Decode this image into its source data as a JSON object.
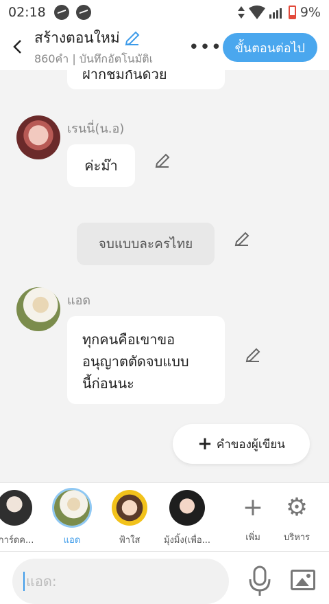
{
  "status": {
    "time": "02:18",
    "battery": "9%"
  },
  "header": {
    "back_glyph": "<",
    "title": "สร้างตอนใหม่",
    "subtitle": "860คำ | บันทึกอัตโนมัติเ",
    "more_glyph": "•••",
    "next_label": "ขั้นตอนต่อไป"
  },
  "chat": {
    "top_partial": "ฝากชมกันด้วย",
    "msg1": {
      "name": "เรนนี่(น.อ)",
      "text": "ค่ะม๊า"
    },
    "narration": "จบแบบละครไทย",
    "msg2": {
      "name": "แอด",
      "lines": [
        "ทุกคนคือเขาขอ",
        "อนุญาตตัดจบแบบ",
        "นี้ก่อนนะ"
      ]
    },
    "author_button": "คำของผู้เขียน",
    "author_plus": "+"
  },
  "characters": [
    {
      "label": "(การ์ดค..."
    },
    {
      "label": "แอด"
    },
    {
      "label": "ฟ้าใส"
    },
    {
      "label": "มุ้งมิ้ง(เพื่อ..."
    }
  ],
  "tools": {
    "add_label": "เพิ่ม",
    "manage_label": "บริหาร",
    "add_glyph": "+",
    "manage_glyph": "⚙"
  },
  "input": {
    "placeholder": "แอด:"
  },
  "colors": {
    "accent": "#4aa7ee",
    "background": "#f3f3f3"
  }
}
